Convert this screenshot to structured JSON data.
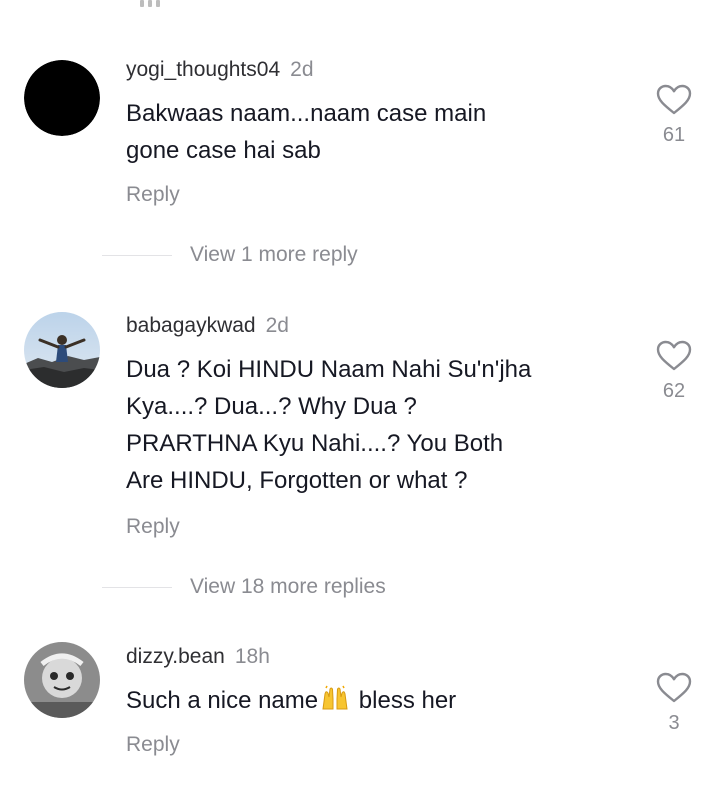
{
  "comments": [
    {
      "username": "yogi_thoughts04",
      "time": "2d",
      "text_lines": [
        "Bakwaas naam...naam case main",
        "gone case hai sab"
      ],
      "reply_label": "Reply",
      "likes": "61",
      "avatar": "black-circle"
    },
    {
      "username": "babagaykwad",
      "time": "2d",
      "text_lines": [
        "Dua ? Koi HINDU Naam Nahi Su'n'jha",
        "Kya....? Dua...? Why Dua ?",
        "PRARTHNA Kyu Nahi....? You Both",
        "Are HINDU, Forgotten or what ?"
      ],
      "reply_label": "Reply",
      "likes": "62",
      "avatar": "person-outdoors-photo"
    },
    {
      "username": "dizzy.bean",
      "time": "18h",
      "text_before_emoji": "Such a nice name",
      "emoji": "raising-hands",
      "text_after_emoji": " bless her",
      "reply_label": "Reply",
      "likes": "3",
      "avatar": "grayscale-cartoon-photo"
    }
  ],
  "view_more": [
    {
      "label": "View 1 more reply"
    },
    {
      "label": "View 18 more replies"
    }
  ],
  "icons": {
    "like": "heart-outline-icon"
  },
  "colors": {
    "username": "#2f2f33",
    "secondary": "#8a8b91",
    "text": "#161823",
    "divider": "#e3e3e6"
  }
}
